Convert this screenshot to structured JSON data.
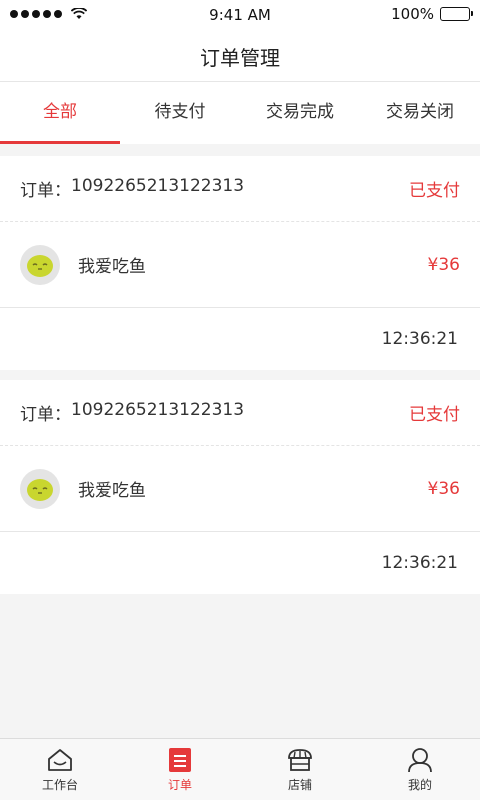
{
  "status_bar": {
    "time": "9:41 AM",
    "battery": "100%"
  },
  "nav": {
    "title": "订单管理"
  },
  "tabs": [
    {
      "label": "全部",
      "active": true
    },
    {
      "label": "待支付",
      "active": false
    },
    {
      "label": "交易完成",
      "active": false
    },
    {
      "label": "交易关闭",
      "active": false
    }
  ],
  "orders": [
    {
      "order_label": "订单：",
      "order_no": "1092265213122313",
      "status": "已支付",
      "item_name": "我爱吃鱼",
      "price": "¥36",
      "time": "12:36:21"
    },
    {
      "order_label": "订单：",
      "order_no": "1092265213122313",
      "status": "已支付",
      "item_name": "我爱吃鱼",
      "price": "¥36",
      "time": "12:36:21"
    }
  ],
  "bottom_nav": [
    {
      "label": "工作台",
      "icon": "home-icon",
      "active": false
    },
    {
      "label": "订单",
      "icon": "order-icon",
      "active": true
    },
    {
      "label": "店铺",
      "icon": "shop-icon",
      "active": false
    },
    {
      "label": "我的",
      "icon": "user-icon",
      "active": false
    }
  ],
  "colors": {
    "accent": "#e5393a",
    "battery": "#2bd14b",
    "avatar_face": "#c9d62f"
  }
}
